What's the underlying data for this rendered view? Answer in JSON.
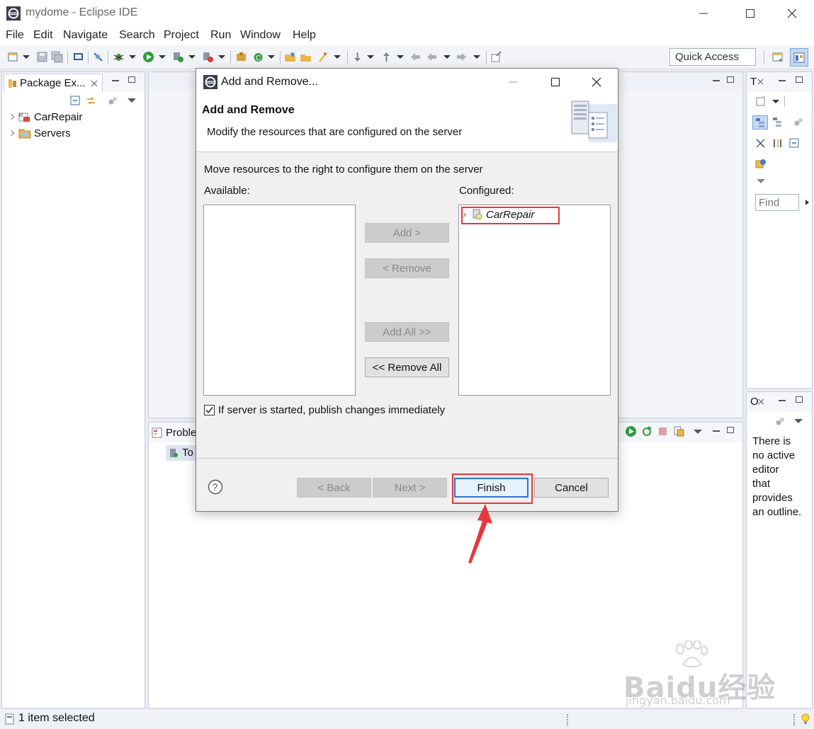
{
  "window": {
    "title": "mydome - Eclipse IDE"
  },
  "menu": [
    "File",
    "Edit",
    "Navigate",
    "Search",
    "Project",
    "Run",
    "Window",
    "Help"
  ],
  "toolbar": {
    "quick_access": "Quick Access"
  },
  "package_explorer": {
    "tab_label": "Package Ex...",
    "items": [
      {
        "label": "CarRepair"
      },
      {
        "label": "Servers"
      }
    ]
  },
  "right_panel_top": {
    "tab_label": "T",
    "find_placeholder": "Find"
  },
  "outline": {
    "tab_label": "O",
    "message": [
      "There is",
      "no active",
      "editor",
      "that",
      "provides",
      "an outline."
    ]
  },
  "bottom_panel": {
    "tab_label": "Proble",
    "row_label": "To"
  },
  "status_bar": {
    "text": "1 item selected"
  },
  "dialog": {
    "title": "Add and Remove...",
    "heading": "Add and Remove",
    "subheading": "Modify the resources that are configured on the server",
    "instruction": "Move resources to the right to configure them on the server",
    "available_label": "Available:",
    "configured_label": "Configured:",
    "configured_items": [
      {
        "label": "CarRepair"
      }
    ],
    "buttons": {
      "add": "Add >",
      "remove": "< Remove",
      "add_all": "Add All >>",
      "remove_all": "<< Remove All",
      "back": "< Back",
      "next": "Next >",
      "finish": "Finish",
      "cancel": "Cancel"
    },
    "publish_checkbox": {
      "label": "If server is started, publish changes immediately",
      "checked": true
    }
  },
  "watermark": {
    "brand": "Baidu经验",
    "url": "jingyan.baidu.com"
  },
  "colors": {
    "highlight": "#e8363a",
    "accent": "#2f74c9"
  }
}
